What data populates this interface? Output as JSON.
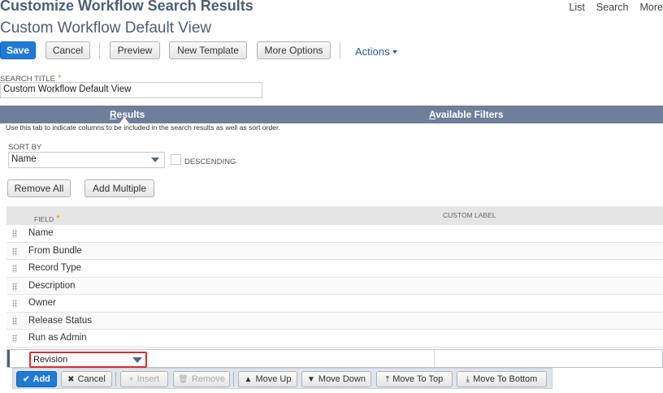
{
  "header": {
    "title": "Customize Workflow Search Results",
    "subtitle": "Custom Workflow Default View",
    "nav": [
      "List",
      "Search",
      "More"
    ]
  },
  "toolbar": {
    "save": "Save",
    "cancel": "Cancel",
    "preview": "Preview",
    "new_template": "New Template",
    "more_options": "More Options",
    "actions": "Actions"
  },
  "search_title": {
    "label": "SEARCH TITLE",
    "required_mark": "*",
    "value": "Custom Workflow Default View"
  },
  "tabs": {
    "results": {
      "first": "R",
      "rest": "esults"
    },
    "available_filters": {
      "first": "A",
      "rest": "vailable Filters"
    }
  },
  "help_text": "Use this tab to indicate columns to be included in the search results as well as sort order.",
  "sort": {
    "label": "SORT BY",
    "value": "Name",
    "descending_label": "DESCENDING"
  },
  "list_buttons": {
    "remove_all": "Remove All",
    "add_multiple": "Add Multiple"
  },
  "grid": {
    "columns": {
      "field": "FIELD",
      "required_mark": "*",
      "custom_label": "CUSTOM LABEL"
    },
    "rows": [
      "Name",
      "From Bundle",
      "Record Type",
      "Description",
      "Owner",
      "Release Status",
      "Run as Admin"
    ],
    "edit_value": "Revision"
  },
  "row_toolbar": {
    "add": "Add",
    "cancel": "Cancel",
    "insert": "Insert",
    "remove": "Remove",
    "move_up": "Move Up",
    "move_down": "Move Down",
    "move_to_top": "Move To Top",
    "move_to_bottom": "Move To Bottom"
  },
  "colors": {
    "brand": "#4d5f79",
    "primary": "#1f7ad6",
    "tabbar": "#6f7f9b",
    "required": "#e3a40c",
    "highlight": "#dd2c2c"
  }
}
